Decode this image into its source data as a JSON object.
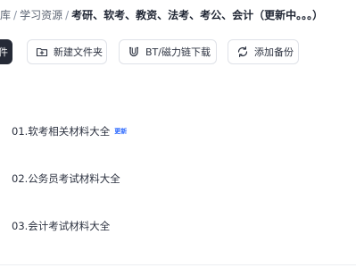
{
  "breadcrumb": {
    "items": [
      "库",
      "学习资源"
    ],
    "separator": "/",
    "current": "考研、软考、教资、法考、考公、会计（更新中。。。）"
  },
  "toolbar": {
    "upload_label": "件",
    "new_folder_label": "新建文件夹",
    "bt_download_label": "BT/磁力链下载",
    "backup_label": "添加备份"
  },
  "files": [
    {
      "name": "01.软考相关材料大全",
      "badge": "更新"
    },
    {
      "name": "02.公务员考试材料大全"
    },
    {
      "name": "03.会计考试材料大全"
    }
  ],
  "colors": {
    "primary_button": "#252a36",
    "badge": "#2f6bff"
  }
}
